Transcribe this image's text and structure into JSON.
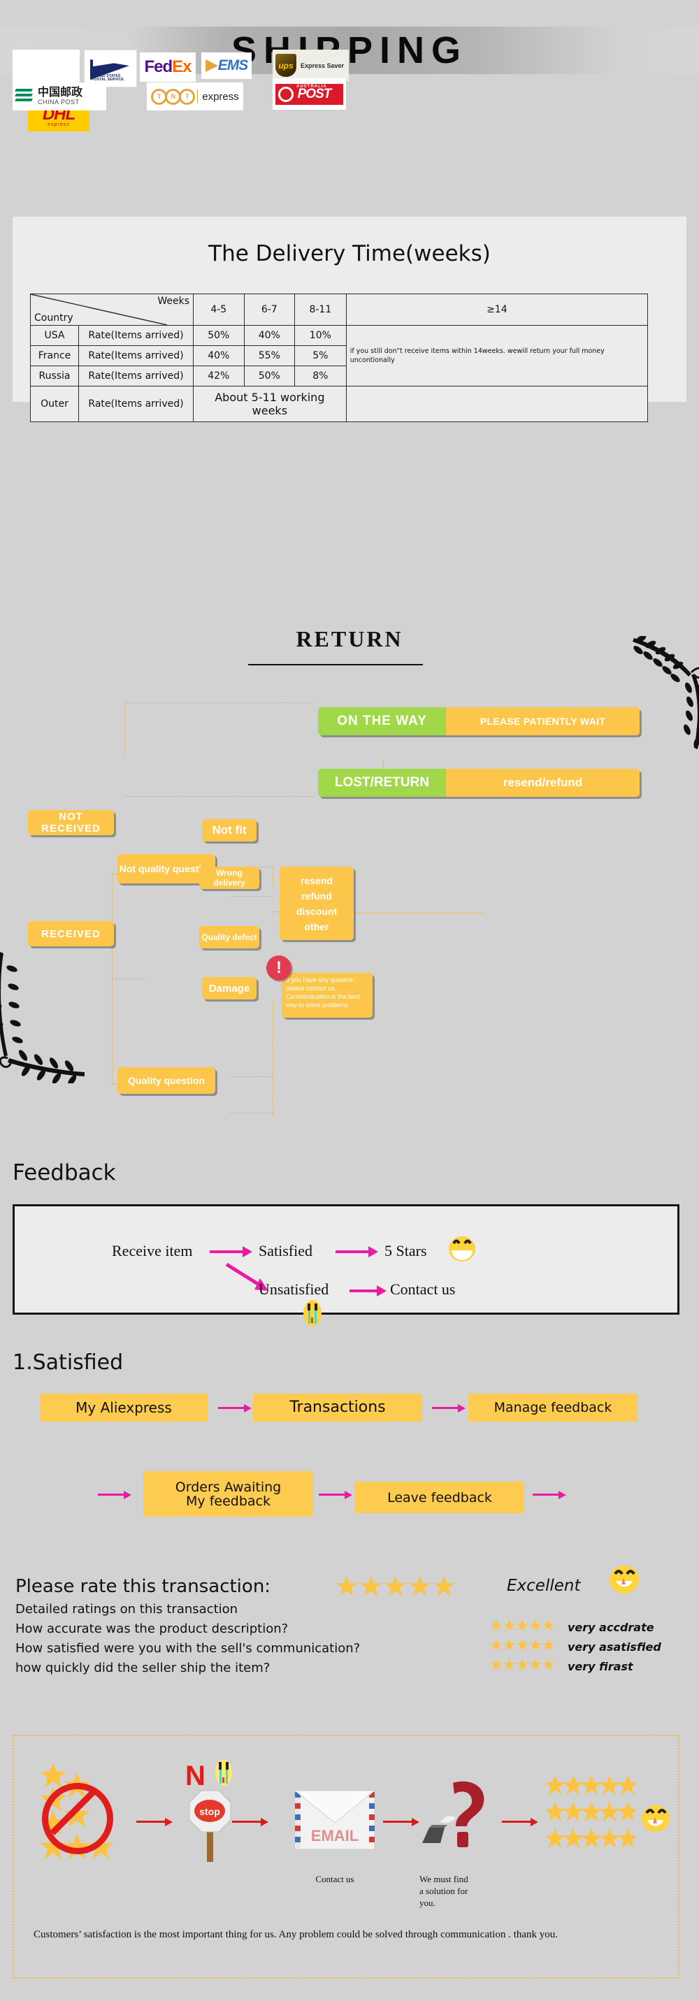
{
  "header": {
    "title": "SHIPPING"
  },
  "carriers": [
    {
      "name": "DHL",
      "label": "DHL",
      "sub": "express"
    },
    {
      "name": "USPS",
      "label": "UNITED STATES POSTAL SERVICE."
    },
    {
      "name": "FedEx",
      "label_a": "Fed",
      "label_b": "Ex"
    },
    {
      "name": "EMS",
      "label": "EMS"
    },
    {
      "name": "UPS",
      "label": "ups",
      "sub": "Express Saver"
    },
    {
      "name": "China Post",
      "label_cn": "中国邮政",
      "label_en": "CHINA POST"
    },
    {
      "name": "TNT",
      "label": "TNT",
      "sub": "express"
    },
    {
      "name": "Australia Post",
      "label_top": "AUSTRALIA",
      "label": "POST"
    }
  ],
  "delivery": {
    "title": "The Delivery Time(weeks)",
    "corner_row": "Weeks",
    "corner_col": "Country",
    "week_headers": [
      "4-5",
      "6-7",
      "8-11",
      "≥14"
    ],
    "rate_label": "Rate(Items arrived)",
    "rows": [
      {
        "country": "USA",
        "rate_label": "Rate(Items arrived)",
        "values": [
          "50%",
          "40%",
          "10%"
        ]
      },
      {
        "country": "France",
        "rate_label": "Rate(Items arrived)",
        "values": [
          "40%",
          "55%",
          "5%"
        ]
      },
      {
        "country": "Russia",
        "rate_label": "Rate(Items arrived)",
        "values": [
          "42%",
          "50%",
          "8%"
        ]
      }
    ],
    "outer": {
      "country": "Outer",
      "rate_label": "Rate(Items arrived)",
      "value": "About 5-11 working weeks"
    },
    "note": "if you still don”t receive items within 14weeks. wewill return your full money uncontionally"
  },
  "return": {
    "title": "RETURN",
    "not_received": "NOT RECEIVED",
    "received": "RECEIVED",
    "on_the_way": {
      "left": "ON THE WAY",
      "right": "PLEASE PATIENTLY WAIT"
    },
    "lost_return": {
      "left": "LOST/RETURN",
      "right": "resend/refund"
    },
    "not_quality_question": "Not quality question",
    "quality_question": "Quality question",
    "not_fit": "Not fit",
    "wrong_delivery": "Wrong delivery",
    "quality_defect": "Quality defect",
    "damage": "Damage",
    "outcomes": [
      "resend",
      "refund",
      "discount",
      "other"
    ],
    "alert_icon": "!",
    "alert_note": "If you have any question, please contoct us. Communication is the best way to solve problems."
  },
  "feedback": {
    "heading": "Feedback",
    "flow": {
      "receive_item": "Receive item",
      "satisfied": "Satisfied",
      "five_stars": "5 Stars",
      "unsatisfied": "Unsatisfied",
      "contact_us": "Contact us"
    },
    "satisfied_heading": "1.Satisfied",
    "steps_row1": [
      "My Aliexpress",
      "Transactions",
      "Manage feedback"
    ],
    "steps_row2": [
      "Orders Awaiting\nMy feedback",
      "Leave feedback"
    ],
    "orders_awaiting_line1": "Orders Awaiting",
    "orders_awaiting_line2": "My feedback",
    "leave_feedback": "Leave feedback"
  },
  "rating": {
    "prompt": "Please rate this transaction:",
    "overall_stars": "★★★★★",
    "overall_word": "Excellent",
    "detail_heading": "Detailed ratings on this transaction",
    "items": [
      {
        "question": "How accurate was the product description?",
        "stars": "★★★★★",
        "verdict": "very accdrate"
      },
      {
        "question": "How satisfied were you with the sell's communication?",
        "stars": "★★★★★",
        "verdict": "very asatisfied"
      },
      {
        "question": "how quickly did the seller ship the item?",
        "stars": "★★★★★",
        "verdict": "very firast"
      }
    ]
  },
  "bottom": {
    "no_label": "N",
    "stop_label": "stop",
    "email_label": "EMAIL",
    "question_mark": "?",
    "contact_us": "Contact us",
    "must_find": "We must find\na solution for\nyou.",
    "must_find_l1": "We must find",
    "must_find_l2": "a solution for",
    "must_find_l3": "you.",
    "footer": "Customers’ satisfaction is the most important thing for us. Any problem could be solved through communication . thank you."
  },
  "colors": {
    "page_bg": "#d2d2d2",
    "panel_bg": "#ececec",
    "yellow": "#fcc64b",
    "green": "#a0d84a",
    "star": "#fcc340",
    "pink_arrow": "#ec19a5",
    "red_arrow": "#d91c15",
    "alert_red": "#e13c4f"
  }
}
